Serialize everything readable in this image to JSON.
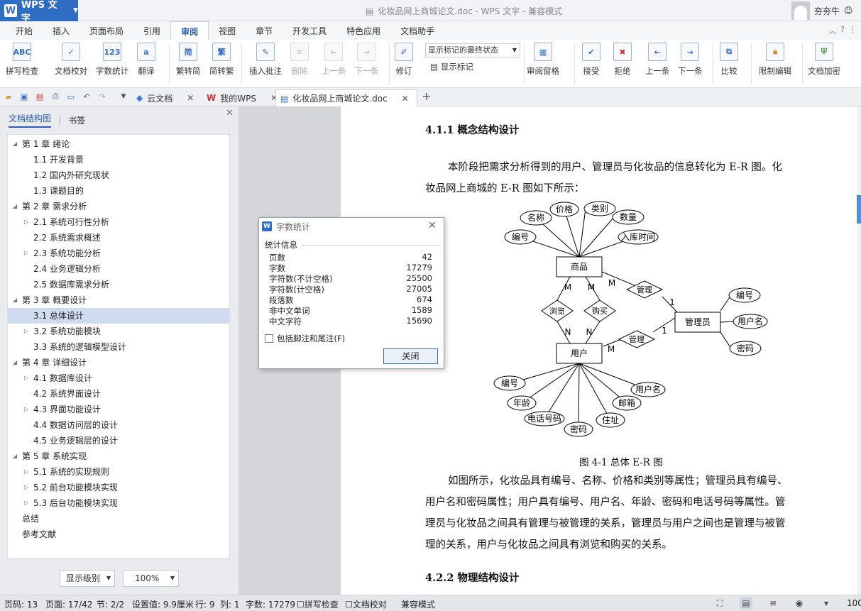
{
  "app": {
    "name": "WPS 文字",
    "logo_letter": "W",
    "window_title": "化妆品网上商城论文.doc - WPS 文字 - 兼容模式",
    "user": "夯夯牛"
  },
  "menu": {
    "tabs": [
      "开始",
      "插入",
      "页面布局",
      "引用",
      "审阅",
      "视图",
      "章节",
      "开发工具",
      "特色应用",
      "文档助手"
    ],
    "active": "审阅"
  },
  "ribbon": {
    "spell_check": "拼写检查",
    "doc_proof": "文档校对",
    "word_count": "字数统计",
    "translate": "翻译",
    "trad_to_simp": "繁转简",
    "simp_to_trad": "简转繁",
    "insert_comment": "插入批注",
    "delete": "删除",
    "prev": "上一条",
    "next": "下一条",
    "revise": "修订",
    "show_mode": "显示标记的最终状态",
    "show_markup": "显示标记",
    "review_pane": "审阅窗格",
    "accept": "接受",
    "reject": "拒绝",
    "prev2": "上一条",
    "next2": "下一条",
    "compare": "比较",
    "restrict_edit": "限制编辑",
    "encrypt": "文档加密",
    "icon_texts": {
      "abc": "ABC",
      "num": "123",
      "trans": "a",
      "simp": "简",
      "trad": "繁"
    }
  },
  "doc_tabs": {
    "cloud": "云文档",
    "my_wps": "我的WPS",
    "current": "化妆品网上商城论文.doc"
  },
  "nav_panel": {
    "tab_structure": "文档结构图",
    "tab_bookmark": "书签",
    "items": [
      {
        "label": "第 1 章   绪论",
        "level": 0,
        "expand": "open"
      },
      {
        "label": "1.1  开发背景",
        "level": 1,
        "expand": "none"
      },
      {
        "label": "1.2  国内外研究现状",
        "level": 1,
        "expand": "none"
      },
      {
        "label": "1.3  课题目的",
        "level": 1,
        "expand": "none"
      },
      {
        "label": "第 2 章   需求分析",
        "level": 0,
        "expand": "open"
      },
      {
        "label": "2.1  系统可行性分析",
        "level": 1,
        "expand": "closed"
      },
      {
        "label": "2.2  系统需求概述",
        "level": 1,
        "expand": "none"
      },
      {
        "label": "2.3  系统功能分析",
        "level": 1,
        "expand": "closed"
      },
      {
        "label": "2.4  业务逻辑分析",
        "level": 1,
        "expand": "none"
      },
      {
        "label": "2.5  数据库需求分析",
        "level": 1,
        "expand": "none"
      },
      {
        "label": "第 3 章  概要设计",
        "level": 0,
        "expand": "open"
      },
      {
        "label": "3.1  总体设计",
        "level": 1,
        "expand": "none",
        "selected": true
      },
      {
        "label": "3.2  系统功能模块",
        "level": 1,
        "expand": "closed"
      },
      {
        "label": "3.3  系统的逻辑模型设计",
        "level": 1,
        "expand": "none"
      },
      {
        "label": "第 4 章   详细设计",
        "level": 0,
        "expand": "open"
      },
      {
        "label": "4.1  数据库设计",
        "level": 1,
        "expand": "closed"
      },
      {
        "label": "4.2  系统界面设计",
        "level": 1,
        "expand": "none"
      },
      {
        "label": "4.3  界面功能设计",
        "level": 1,
        "expand": "closed"
      },
      {
        "label": "4.4  数据访问层的设计",
        "level": 1,
        "expand": "none"
      },
      {
        "label": "4.5  业务逻辑层的设计",
        "level": 1,
        "expand": "none"
      },
      {
        "label": "第 5 章    系统实现",
        "level": 0,
        "expand": "open"
      },
      {
        "label": "5.1  系统的实现规则",
        "level": 1,
        "expand": "closed"
      },
      {
        "label": "5.2  前台功能模块实现",
        "level": 1,
        "expand": "closed"
      },
      {
        "label": "5.3  后台功能模块实现",
        "level": 1,
        "expand": "closed"
      },
      {
        "label": "总结",
        "level": 0,
        "expand": "none"
      },
      {
        "label": "参考文献",
        "level": 0,
        "expand": "none"
      }
    ],
    "display_level": "显示级别",
    "zoom": "100%"
  },
  "document": {
    "heading1": "4.1.1  概念结构设计",
    "para1": [
      "本阶段把需求分析得到的用户、管理员与化妆品的信息转化为 E-R 图。化",
      "妆品网上商城的 E-R 图如下所示："
    ],
    "figure_caption": "图 4-1   总体 E-R 图",
    "para2": [
      "如图所示，化妆品具有编号、名称、价格和类别等属性；管理员具有编号、",
      "用户名和密码属性；用户具有编号、用户名、年龄、密码和电话号码等属性。管",
      "理员与化妆品之间具有管理与被管理的关系，管理员与用户之间也是管理与被管",
      "理的关系，用户与化妆品之间具有浏览和购买的关系。"
    ],
    "heading2": "4.2.2  物理结构设计"
  },
  "er_diagram": {
    "entities": {
      "product": "商品",
      "admin": "管理员",
      "user": "用户"
    },
    "relations": {
      "browse": "浏览",
      "buy": "购买",
      "manage1": "管理",
      "manage2": "管理"
    },
    "product_attrs": [
      "名称",
      "价格",
      "类别",
      "数量",
      "编号",
      "入库时间"
    ],
    "admin_attrs": [
      "编号",
      "用户名",
      "密码"
    ],
    "user_attrs": [
      "编号",
      "年龄",
      "电话号码",
      "密码",
      "住址",
      "邮箱",
      "用户名"
    ],
    "card": {
      "m": "M",
      "n": "N",
      "one": "1"
    }
  },
  "dialog": {
    "title": "字数统计",
    "section": "统计信息",
    "rows": [
      {
        "label": "页数",
        "value": "42"
      },
      {
        "label": "字数",
        "value": "17279"
      },
      {
        "label": "字符数(不计空格)",
        "value": "25500"
      },
      {
        "label": "字符数(计空格)",
        "value": "27005"
      },
      {
        "label": "段落数",
        "value": "674"
      },
      {
        "label": "非中文单词",
        "value": "1589"
      },
      {
        "label": "中文字符",
        "value": "15690"
      }
    ],
    "checkbox": "包括脚注和尾注(F)",
    "close": "关闭"
  },
  "status": {
    "page_num": "页码: 13",
    "page": "页面: 17/42",
    "section": "节: 2/2",
    "setting": "设置值: 9.9厘米",
    "row": "行: 9",
    "col": "列: 1",
    "words": "字数: 17279",
    "spell": "拼写检查",
    "proof": "文档校对",
    "compat": "兼容模式",
    "zoom": "100"
  }
}
